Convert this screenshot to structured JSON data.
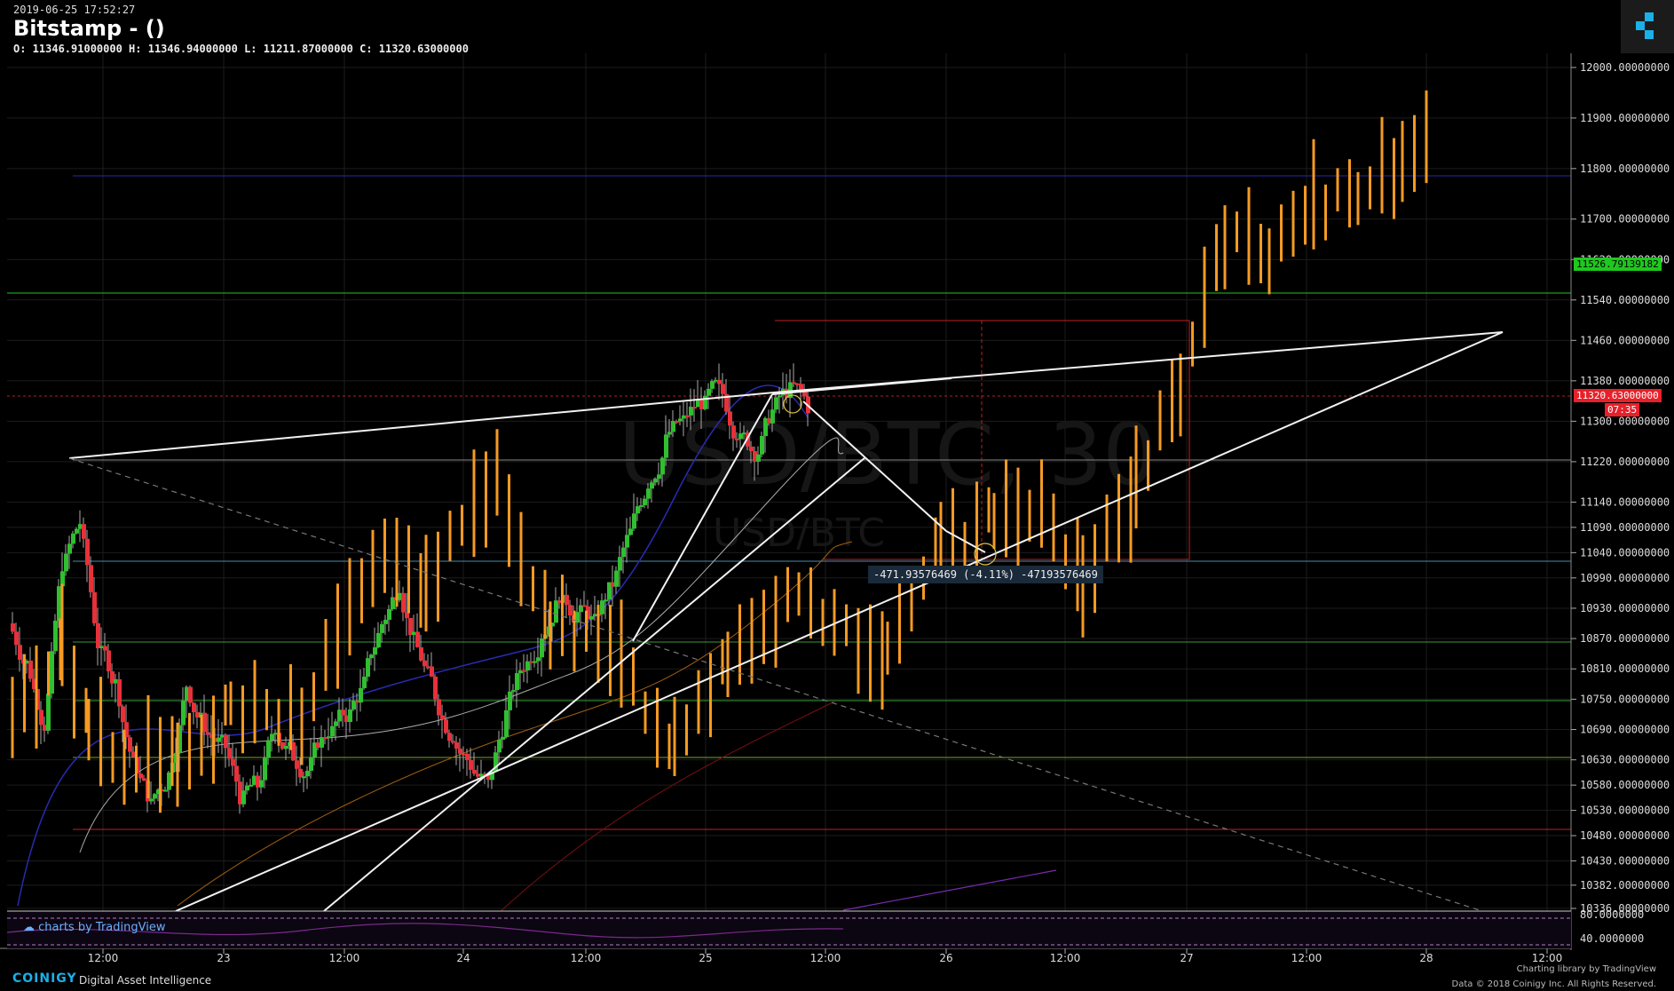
{
  "header": {
    "timestamp": "2019-06-25 17:52:27",
    "title": "Bitstamp -  ()",
    "ohlc": "O: 11346.91000000 H: 11346.94000000 L: 11211.87000000 C: 11320.63000000"
  },
  "watermark": {
    "symbol": "USD/BTC, 30",
    "sub": "USD/BTC"
  },
  "chart_data": {
    "type": "candlestick",
    "y_ticks": [
      "12000.00000000",
      "11900.00000000",
      "11800.00000000",
      "11700.00000000",
      "11620.00000000",
      "11540.00000000",
      "11460.00000000",
      "11380.00000000",
      "11300.00000000",
      "11220.00000000",
      "11140.00000000",
      "11090.00000000",
      "11040.00000000",
      "10990.00000000",
      "10930.00000000",
      "10870.00000000",
      "10810.00000000",
      "10750.00000000",
      "10690.00000000",
      "10630.00000000",
      "10580.00000000",
      "10530.00000000",
      "10480.00000000",
      "10430.00000000",
      "10382.00000000",
      "10336.00000000"
    ],
    "x_ticks": [
      "12:00",
      "23",
      "12:00",
      "24",
      "12:00",
      "25",
      "12:00",
      "26",
      "12:00",
      "27",
      "12:00",
      "28",
      "12:00"
    ],
    "current_price": "11320.63000000",
    "countdown": "07:35",
    "level_price": "11526.79139182",
    "measure_label": "-471.93576469 (-4.11%) -47193576469",
    "indicator_ticks": [
      "80.0000000",
      "40.0000000"
    ],
    "colors": {
      "up": "#2fbf2f",
      "down": "#e8303a",
      "projection": "#f59a23",
      "grid": "#1c1c1c"
    }
  },
  "tv_badge": "charts by TradingView",
  "footer": {
    "brand": "COINIGY",
    "brand_sub": "Digital Asset Intelligence",
    "credit_line1": "Charting library by  TradingView",
    "credit_line2": "Data © 2018  Coinigy Inc. All Rights Reserved."
  }
}
